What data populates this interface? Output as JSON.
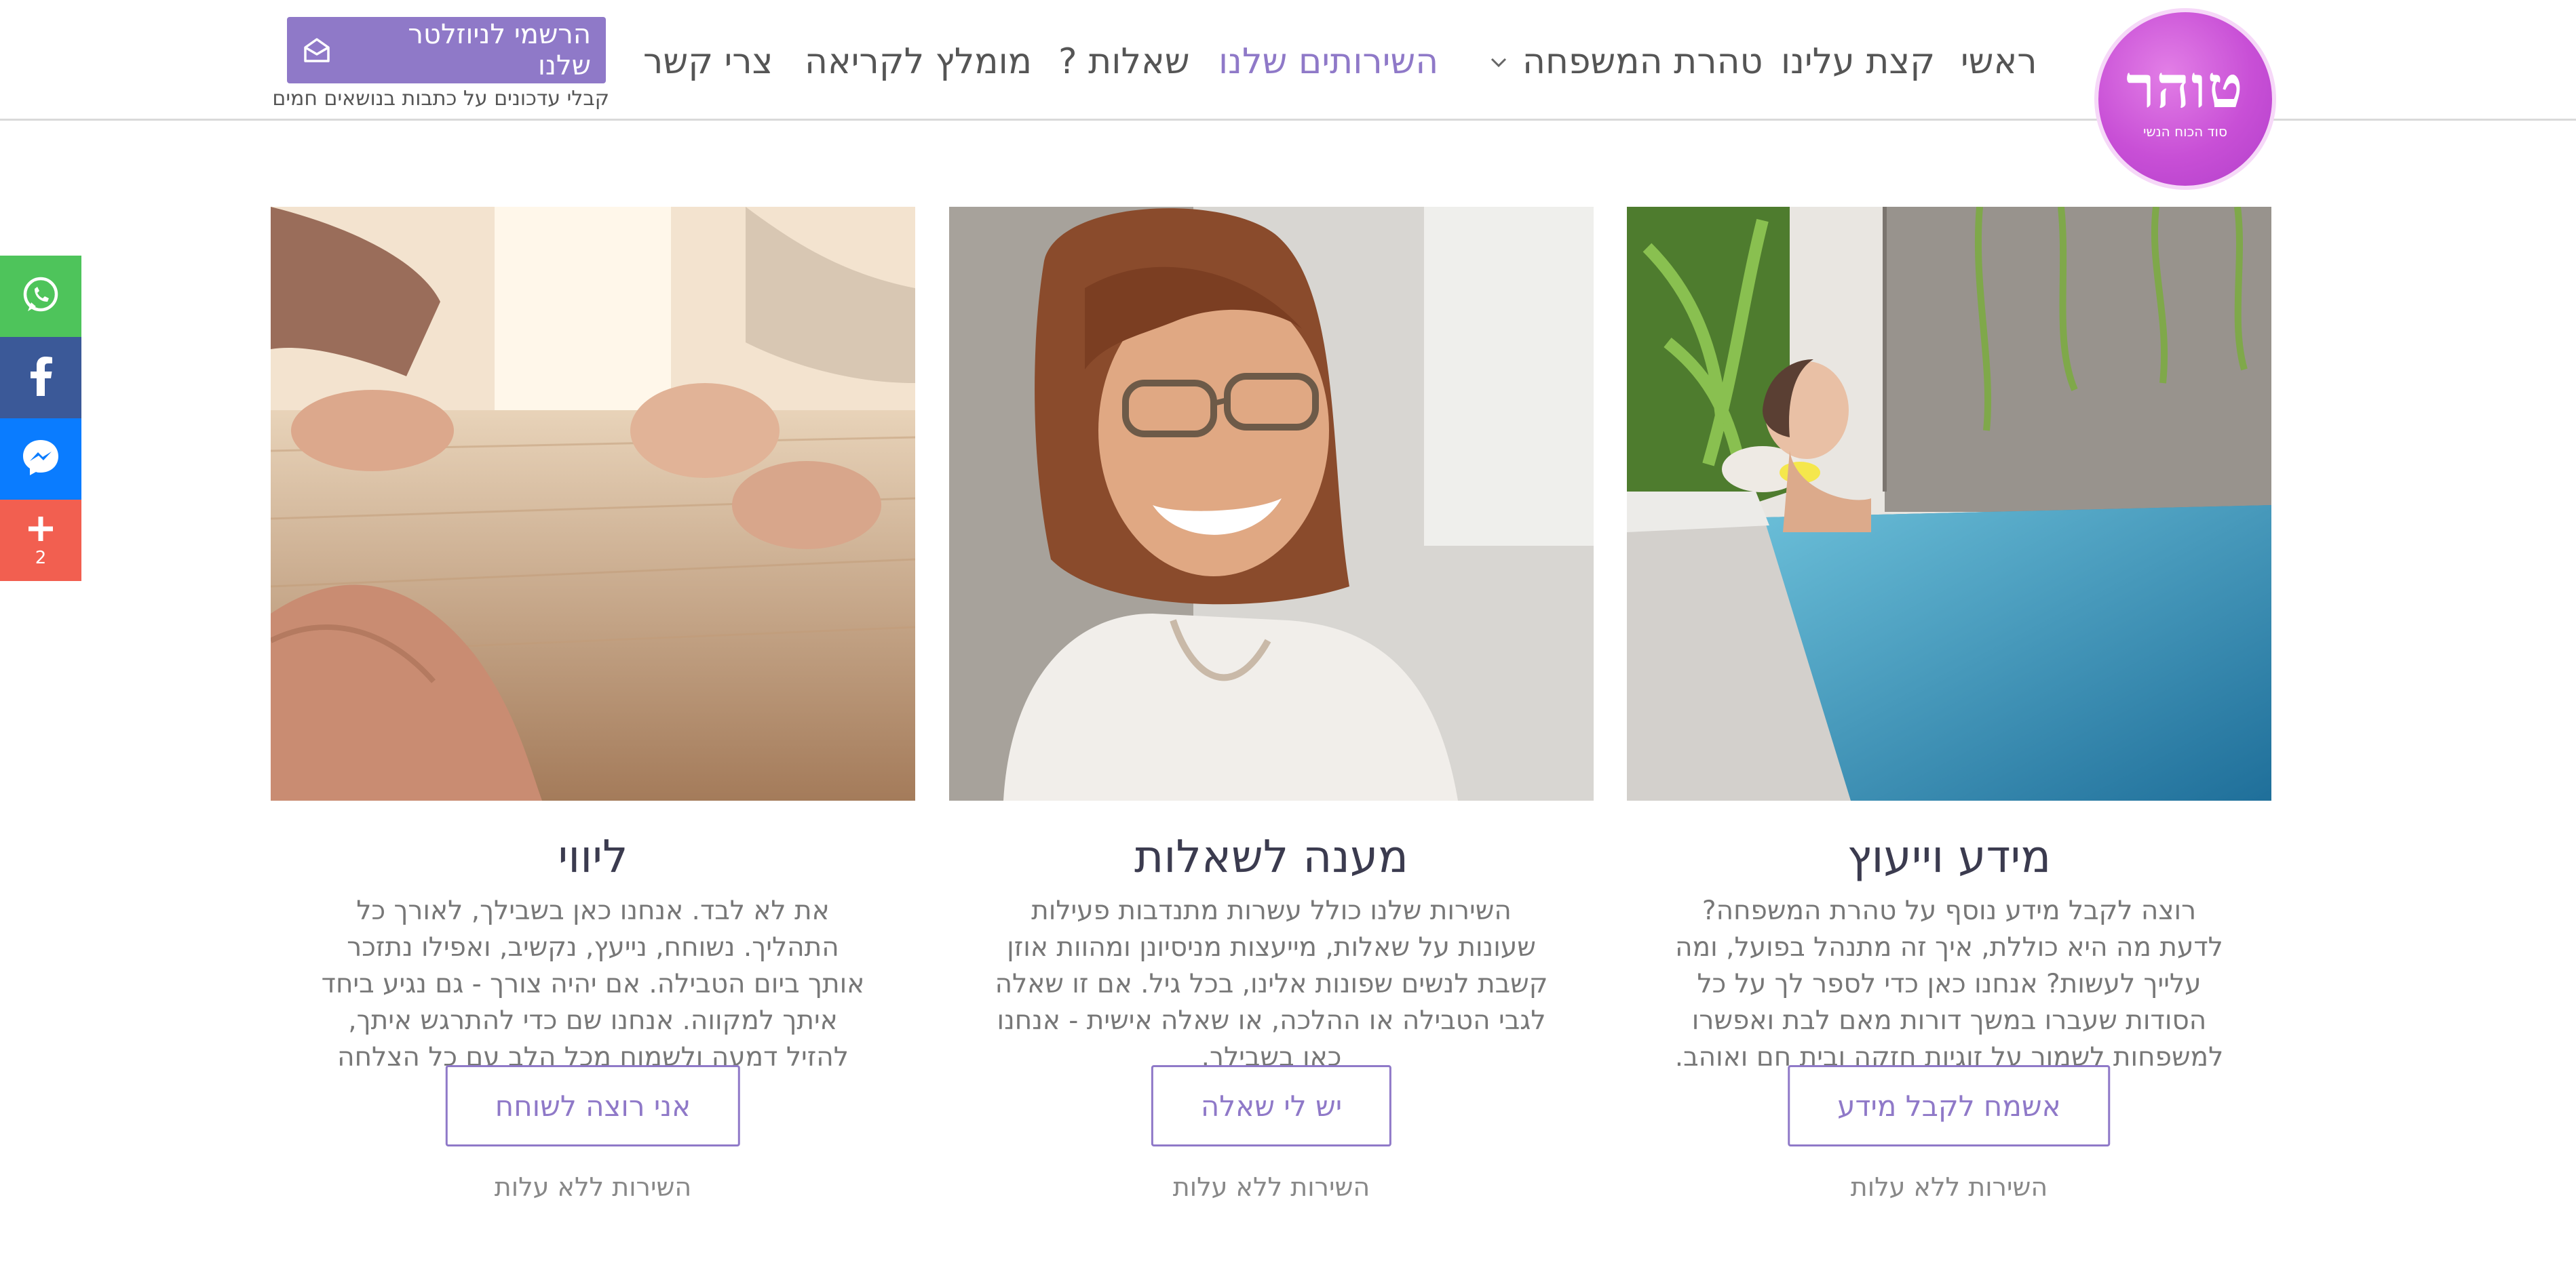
{
  "header": {
    "logo": {
      "main": "טוהר",
      "sub": "סוד הכוח הנשי"
    },
    "nav": {
      "home": "ראשי",
      "about": "קצת עלינו",
      "family_purity": "טהרת המשפחה",
      "services": "השירותים שלנו",
      "questions": "שאלות ?",
      "recommended": "מומלץ לקריאה",
      "contact": "צרי קשר"
    },
    "newsletter": {
      "button_label": "הרשמי לניוזלטר שלנו",
      "subtitle": "קבלי עדכונים על כתבות בנושאים חמים"
    }
  },
  "social": {
    "icons": [
      "whatsapp-icon",
      "facebook-icon",
      "messenger-icon",
      "plus-icon"
    ],
    "share_count": "2",
    "colors": {
      "whatsapp": "#4ec45b",
      "facebook": "#3b5998",
      "messenger": "#0a7cff",
      "more": "#f25f50"
    }
  },
  "services": [
    {
      "title": "מידע וייעוץ",
      "text": "רוצה לקבל מידע נוסף על טהרת המשפחה? לדעת מה היא כוללת, איך זה מתנהל בפועל, ומה עלייך לעשות? אנחנו כאן כדי לספר לך על כל הסודות שעברו במשך דורות מאם לבת ואפשרו למשפחות לשמור על זוגיות חזקה ובית חם ואוהב.",
      "button": "אשמח לקבל מידע",
      "free": "השירות ללא עלות"
    },
    {
      "title": "מענה לשאלות",
      "text": "השירות שלנו כולל עשרות מתנדבות פעילות שעונות על שאלות, מייעצות מניסיונן ומהוות אוזן קשבת לנשים שפונות אלינו, בכל גיל. אם זו שאלה לגבי הטבילה או ההלכה, או שאלה אישית - אנחנו כאן בשבילך.",
      "button": "יש לי שאלה",
      "free": "השירות ללא עלות"
    },
    {
      "title": "ליווי",
      "text": "את לא לבד. אנחנו כאן בשבילך, לאורך כל התהליך. נשוחח, נייעץ, נקשיב, ואפילו נתזכר אותך ביום הטבילה. אם יהיה צורך - גם נגיע ביחד איתך למקווה. אנחנו שם כדי להתרגש איתך, להזיל דמעה ולשמוח מכל הלב עם כל הצלחה שאת חווה.",
      "button": "אני רוצה לשוחח",
      "free": "השירות ללא עלות"
    }
  ],
  "colors": {
    "accent": "#8f79c8",
    "logo": "#c84fd6"
  }
}
